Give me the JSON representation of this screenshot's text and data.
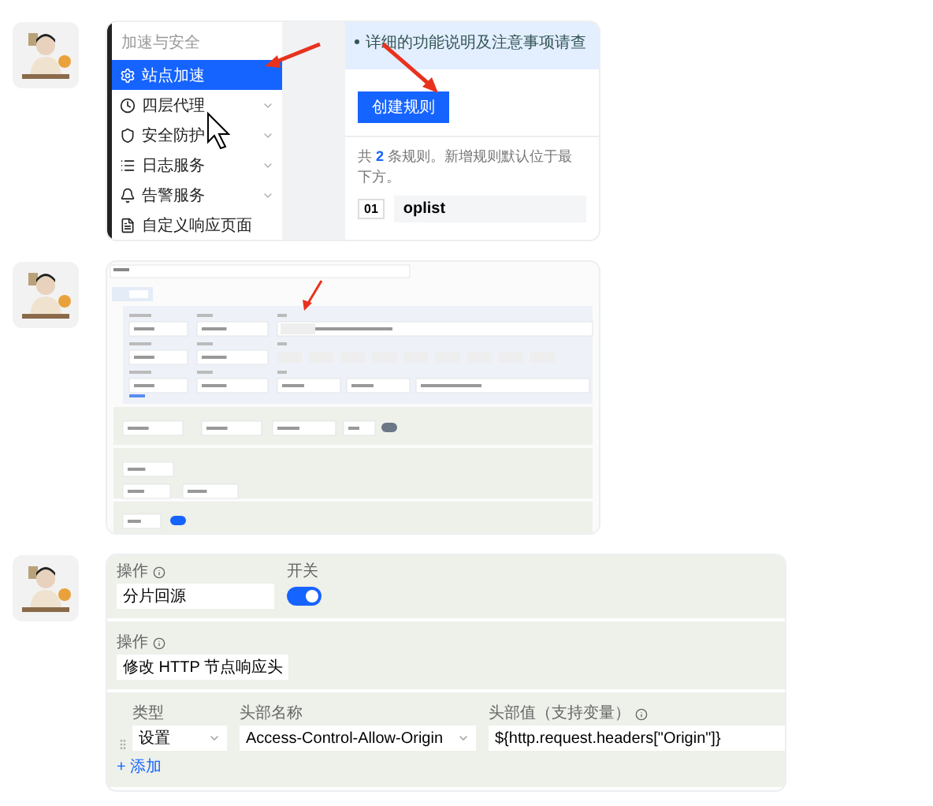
{
  "messages": [
    {
      "kind": "console",
      "sidebar": {
        "heading": "加速与安全",
        "items": [
          {
            "label": "站点加速",
            "selected": true,
            "expandable": false
          },
          {
            "label": "四层代理",
            "selected": false,
            "expandable": true
          },
          {
            "label": "安全防护",
            "selected": false,
            "expandable": true
          },
          {
            "label": "日志服务",
            "selected": false,
            "expandable": true
          },
          {
            "label": "告警服务",
            "selected": false,
            "expandable": true
          },
          {
            "label": "自定义响应页面",
            "selected": false,
            "expandable": false
          }
        ]
      },
      "banner": "详细的功能说明及注意事项请查",
      "create_button": "创建规则",
      "summary": "共 **2** 条规则。新增规则默认位于最下方。",
      "rule": {
        "index": "01",
        "name": "oplist"
      }
    },
    {
      "kind": "form-drawing"
    },
    {
      "kind": "actions",
      "sections": [
        {
          "fields": [
            {
              "kind": "text",
              "label": "操作",
              "info": true,
              "value": "分片回源"
            },
            {
              "kind": "switch",
              "label": "开关",
              "on": true
            }
          ]
        },
        {
          "fields": [
            {
              "kind": "text",
              "label": "操作",
              "info": true,
              "value": "修改 HTTP 节点响应头"
            }
          ]
        },
        {
          "fields": [
            {
              "kind": "select",
              "label": "类型",
              "value": "设置"
            },
            {
              "kind": "select",
              "label": "头部名称",
              "value": "Access-Control-Allow-Origin"
            },
            {
              "kind": "text",
              "label": "头部值（支持变量）",
              "info": true,
              "value": "${http.request.headers[\"Origin\"]}"
            }
          ],
          "add_link": "+ 添加"
        }
      ]
    }
  ]
}
